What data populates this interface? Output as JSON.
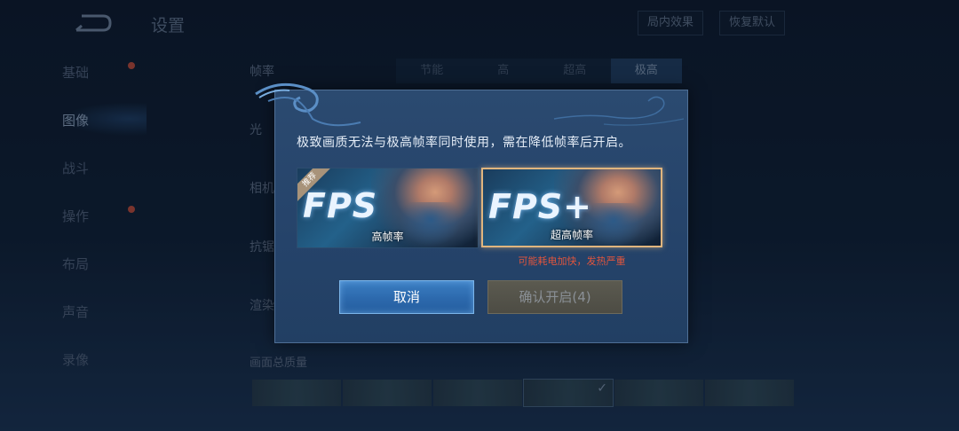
{
  "header": {
    "title": "设置",
    "in_game_effect_label": "局内效果",
    "restore_default_label": "恢复默认"
  },
  "sidebar": {
    "items": [
      {
        "label": "基础",
        "badge": true
      },
      {
        "label": "图像",
        "active": true
      },
      {
        "label": "战斗"
      },
      {
        "label": "操作",
        "badge": true
      },
      {
        "label": "布局"
      },
      {
        "label": "声音"
      },
      {
        "label": "录像"
      }
    ]
  },
  "settings": {
    "frame_rate_label": "帧率",
    "frame_rate_options": [
      "节能",
      "高",
      "超高",
      "极高"
    ],
    "frame_rate_selected": "极高",
    "row_labels": [
      "光",
      "相机",
      "抗锯",
      "渲染"
    ],
    "quality_label": "画面总质量"
  },
  "dialog": {
    "message": "极致画质无法与极高帧率同时使用，需在降低帧率后开启。",
    "option_high": {
      "fps_text": "FPS",
      "label": "高帧率",
      "ribbon": "推荐"
    },
    "option_ultra": {
      "fps_text": "FPS+",
      "label": "超高帧率"
    },
    "warning": "可能耗电加快，发热严重",
    "cancel_label": "取消",
    "confirm_label": "确认开启(4)"
  },
  "colors": {
    "accent_blue": "#2c69ad",
    "warning_red": "#e0553d",
    "selected_border": "#e0b57e"
  }
}
